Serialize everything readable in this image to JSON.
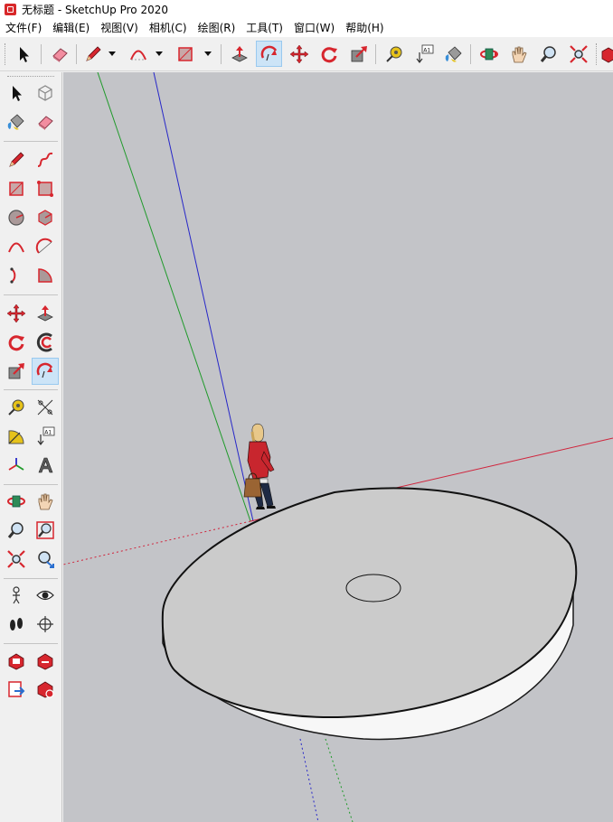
{
  "window": {
    "title": "无标题 - SketchUp Pro 2020"
  },
  "menu": {
    "items": [
      "文件(F)",
      "编辑(E)",
      "视图(V)",
      "相机(C)",
      "绘图(R)",
      "工具(T)",
      "窗口(W)",
      "帮助(H)"
    ]
  },
  "toolbar": {
    "tools": [
      "select-icon",
      "eraser-icon",
      "pencil-icon",
      "arc-icon",
      "rectangle-icon",
      "push-pull-icon",
      "follow-me-icon",
      "move-icon",
      "rotate-icon",
      "scale-icon",
      "tape-measure-icon",
      "text-icon",
      "paint-bucket-icon",
      "orbit-icon",
      "pan-icon",
      "zoom-icon",
      "zoom-extents-icon",
      "3d-warehouse-icon"
    ],
    "active_tool": "follow-me-icon",
    "text_tool_glyph": "A1"
  },
  "sidebar": {
    "active_tool": "follow-me-icon",
    "text_tool_glyph": "A1"
  },
  "colors": {
    "viewport_bg": "#c3c4c8",
    "axis_red": "#d0243c",
    "axis_green": "#1f9a2a",
    "axis_blue": "#2727c8",
    "active_tool_bg": "#cce4f7",
    "tool_red": "#d7262e"
  }
}
